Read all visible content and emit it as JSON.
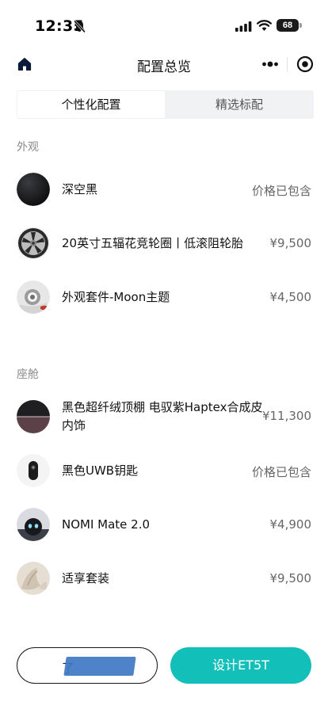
{
  "status_bar": {
    "time": "12:35",
    "battery": "68",
    "icons": [
      "bell-off-icon",
      "signal-icon",
      "wifi-icon",
      "battery-icon"
    ]
  },
  "nav": {
    "title": "配置总览",
    "icons": [
      "home-icon",
      "more-icon",
      "target-icon"
    ]
  },
  "tabs": [
    {
      "label": "个性化配置",
      "active": true
    },
    {
      "label": "精选标配",
      "active": false
    }
  ],
  "sections": {
    "exterior": {
      "title": "外观",
      "items": [
        {
          "name": "深空黑",
          "price": "价格已包含",
          "thumb": "black-paint-swatch"
        },
        {
          "name": "20英寸五辐花竞轮圈丨低滚阻轮胎",
          "price": "¥9,500",
          "thumb": "wheel-rim"
        },
        {
          "name": "外观套件-Moon主题",
          "price": "¥4,500",
          "thumb": "exterior-kit"
        }
      ]
    },
    "cabin": {
      "title": "座舱",
      "items": [
        {
          "name": "黑色超纤绒顶棚 电驭紫Haptex合成皮内饰",
          "price": "¥11,300",
          "thumb": "interior-swatch"
        },
        {
          "name": "黑色UWB钥匙",
          "price": "价格已包含",
          "thumb": "uwb-key"
        },
        {
          "name": "NOMI Mate 2.0",
          "price": "¥4,900",
          "thumb": "nomi-mate"
        },
        {
          "name": "适享套装",
          "price": "¥9,500",
          "thumb": "comfort-package"
        }
      ]
    }
  },
  "bottom": {
    "secondary_label": "了",
    "primary_label": "设计ET5T"
  },
  "colors": {
    "accent": "#12bfb9",
    "tab_bg": "#f1f2f4",
    "muted_text": "#8a8a8a"
  }
}
